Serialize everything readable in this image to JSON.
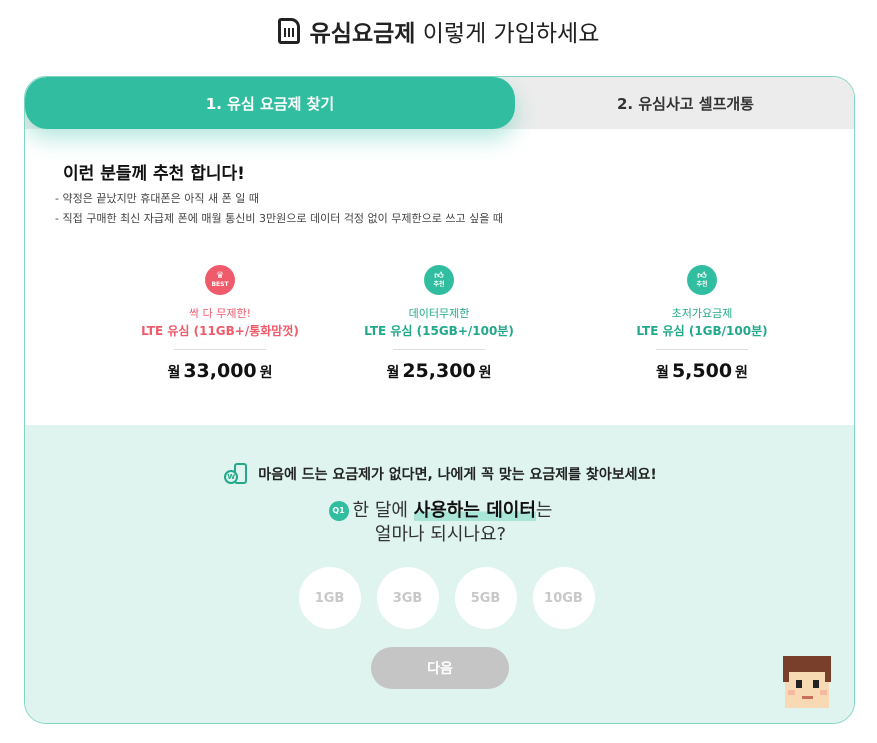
{
  "header": {
    "title_strong": "유심요금제",
    "title_rest": "이렇게 가입하세요"
  },
  "tabs": [
    {
      "label": "1. 유심 요금제 찾기",
      "active": true
    },
    {
      "label": "2. 유심사고 셀프개통",
      "active": false
    }
  ],
  "recommend": {
    "title": "이런 분들께 추천 합니다!",
    "items": [
      "약정은 끝났지만 휴대폰은 아직 새 폰 일 때",
      "직접 구매한 최신 자급제 폰에 매월 통신비 3만원으로 데이터 걱정 없이 무제한으로 쓰고 싶을 때"
    ]
  },
  "plans": [
    {
      "badge": "BEST",
      "line1": "싹 다 무제한!",
      "line2": "LTE 유심 (11GB+/통화맘껏)",
      "price_prefix": "월",
      "price": "33,000",
      "price_suffix": "원"
    },
    {
      "badge": "추천",
      "line1": "데이터무제한",
      "line2": "LTE 유심 (15GB+/100분)",
      "price_prefix": "월",
      "price": "25,300",
      "price_suffix": "원"
    },
    {
      "badge": "추천",
      "line1": "초저가요금제",
      "line2": "LTE 유심 (1GB/100분)",
      "price_prefix": "월",
      "price": "5,500",
      "price_suffix": "원"
    }
  ],
  "finder": {
    "heading": "마음에 드는 요금제가 없다면, 나에게 꼭 맞는 요금제를 찾아보세요!",
    "q_badge": "Q1",
    "q_pre": "한 달에",
    "q_highlight": "사용하는 데이터",
    "q_post": "는",
    "q_line2": "얼마나 되시나요?",
    "options": [
      "1GB",
      "3GB",
      "5GB",
      "10GB"
    ],
    "next_label": "다음"
  },
  "colors": {
    "accent": "#31bea0",
    "pink": "#f05b6b",
    "finder_bg": "#dff4ee"
  }
}
